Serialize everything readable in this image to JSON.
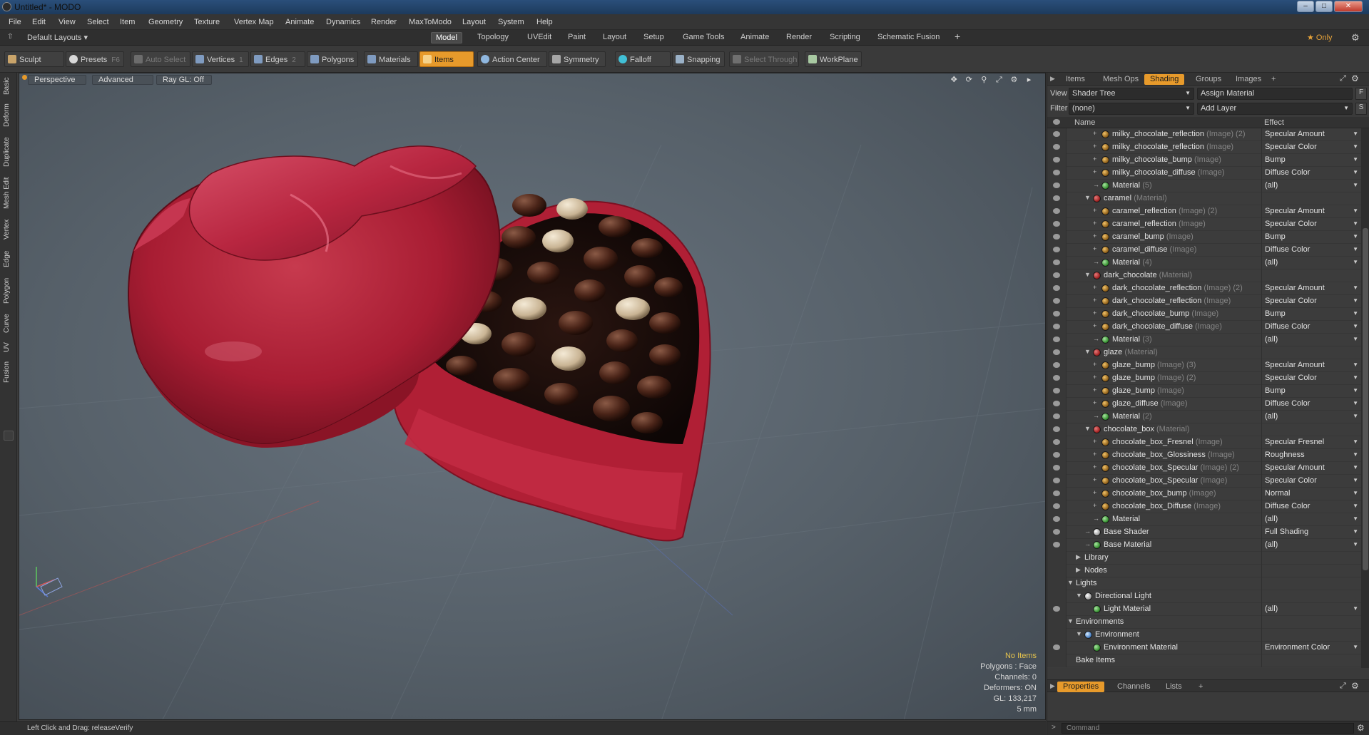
{
  "window": {
    "title": "Untitled* - MODO"
  },
  "menu": [
    "File",
    "Edit",
    "View",
    "Select",
    "Item",
    "Geometry",
    "Texture",
    "Vertex Map",
    "Animate",
    "Dynamics",
    "Render",
    "MaxToModo",
    "Layout",
    "System",
    "Help"
  ],
  "layoutbar": {
    "layout_select": "Default Layouts ▾",
    "tabs": [
      "Model",
      "Topology",
      "UVEdit",
      "Paint",
      "Layout",
      "Setup",
      "Game Tools",
      "Animate",
      "Render",
      "Scripting",
      "Schematic Fusion"
    ],
    "active_tab": "Model",
    "add": "+",
    "only_label": "★ Only"
  },
  "toolbar": {
    "sculpt": "Sculpt",
    "presets": "Presets",
    "presets_key": "F6",
    "auto_select": "Auto Select",
    "vertices": "Vertices",
    "vertices_key": "1",
    "edges": "Edges",
    "edges_key": "2",
    "polygons": "Polygons",
    "materials": "Materials",
    "items": "Items",
    "action_center": "Action Center",
    "symmetry": "Symmetry",
    "falloff": "Falloff",
    "snapping": "Snapping",
    "select_through": "Select Through",
    "workplane": "WorkPlane"
  },
  "left_tabs": [
    "Basic",
    "Deform",
    "Duplicate",
    "Mesh Edit",
    "Vertex",
    "Edge",
    "Polygon",
    "Curve",
    "UV",
    "Fusion"
  ],
  "viewport": {
    "view_mode": "Perspective",
    "shading": "Advanced",
    "raygl": "Ray GL: Off",
    "info": {
      "no_items": "No Items",
      "polygons": "Polygons : Face",
      "channels": "Channels: 0",
      "deformers": "Deformers: ON",
      "gl": "GL: 133,217",
      "scale": "5 mm"
    }
  },
  "status": {
    "text": "Left Click and Drag:   releaseVerify"
  },
  "right_panel": {
    "tabs": [
      "Items",
      "Mesh Ops",
      "Shading",
      "Groups",
      "Images"
    ],
    "active_tab": "Shading",
    "add": "+",
    "view_label": "View",
    "view_value": "Shader Tree",
    "assign_material": "Assign Material",
    "assign_btn": "F",
    "filter_label": "Filter",
    "filter_value": "(none)",
    "add_layer": "Add Layer",
    "add_layer_btn": "S",
    "col_name": "Name",
    "col_effect": "Effect",
    "rows": [
      {
        "name": "milky_chocolate_reflection",
        "type": "(Image) (2)",
        "effect": "Specular Amount",
        "icon": "img",
        "depth": 3,
        "tw": "+"
      },
      {
        "name": "milky_chocolate_reflection",
        "type": "(Image)",
        "effect": "Specular Color",
        "icon": "img",
        "depth": 3,
        "tw": "+"
      },
      {
        "name": "milky_chocolate_bump",
        "type": "(Image)",
        "effect": "Bump",
        "icon": "img",
        "depth": 3,
        "tw": "+"
      },
      {
        "name": "milky_chocolate_diffuse",
        "type": "(Image)",
        "effect": "Diffuse Color",
        "icon": "img",
        "depth": 3,
        "tw": "+"
      },
      {
        "name": "Material",
        "type": "(5)",
        "effect": "(all)",
        "icon": "grn",
        "depth": 3,
        "tw": "→"
      },
      {
        "name": "caramel",
        "type": "(Material)",
        "effect": "",
        "icon": "mat",
        "depth": 2,
        "tw": "▼"
      },
      {
        "name": "caramel_reflection",
        "type": "(Image) (2)",
        "effect": "Specular Amount",
        "icon": "img",
        "depth": 3,
        "tw": "+"
      },
      {
        "name": "caramel_reflection",
        "type": "(Image)",
        "effect": "Specular Color",
        "icon": "img",
        "depth": 3,
        "tw": "+"
      },
      {
        "name": "caramel_bump",
        "type": "(Image)",
        "effect": "Bump",
        "icon": "img",
        "depth": 3,
        "tw": "+"
      },
      {
        "name": "caramel_diffuse",
        "type": "(Image)",
        "effect": "Diffuse Color",
        "icon": "img",
        "depth": 3,
        "tw": "+"
      },
      {
        "name": "Material",
        "type": "(4)",
        "effect": "(all)",
        "icon": "grn",
        "depth": 3,
        "tw": "→"
      },
      {
        "name": "dark_chocolate",
        "type": "(Material)",
        "effect": "",
        "icon": "mat",
        "depth": 2,
        "tw": "▼"
      },
      {
        "name": "dark_chocolate_reflection",
        "type": "(Image) (2)",
        "effect": "Specular Amount",
        "icon": "img",
        "depth": 3,
        "tw": "+"
      },
      {
        "name": "dark_chocolate_reflection",
        "type": "(Image)",
        "effect": "Specular Color",
        "icon": "img",
        "depth": 3,
        "tw": "+"
      },
      {
        "name": "dark_chocolate_bump",
        "type": "(Image)",
        "effect": "Bump",
        "icon": "img",
        "depth": 3,
        "tw": "+"
      },
      {
        "name": "dark_chocolate_diffuse",
        "type": "(Image)",
        "effect": "Diffuse Color",
        "icon": "img",
        "depth": 3,
        "tw": "+"
      },
      {
        "name": "Material",
        "type": "(3)",
        "effect": "(all)",
        "icon": "grn",
        "depth": 3,
        "tw": "→"
      },
      {
        "name": "glaze",
        "type": "(Material)",
        "effect": "",
        "icon": "mat",
        "depth": 2,
        "tw": "▼"
      },
      {
        "name": "glaze_bump",
        "type": "(Image) (3)",
        "effect": "Specular Amount",
        "icon": "img",
        "depth": 3,
        "tw": "+"
      },
      {
        "name": "glaze_bump",
        "type": "(Image) (2)",
        "effect": "Specular Color",
        "icon": "img",
        "depth": 3,
        "tw": "+"
      },
      {
        "name": "glaze_bump",
        "type": "(Image)",
        "effect": "Bump",
        "icon": "img",
        "depth": 3,
        "tw": "+"
      },
      {
        "name": "glaze_diffuse",
        "type": "(Image)",
        "effect": "Diffuse Color",
        "icon": "img",
        "depth": 3,
        "tw": "+"
      },
      {
        "name": "Material",
        "type": "(2)",
        "effect": "(all)",
        "icon": "grn",
        "depth": 3,
        "tw": "→"
      },
      {
        "name": "chocolate_box",
        "type": "(Material)",
        "effect": "",
        "icon": "mat",
        "depth": 2,
        "tw": "▼"
      },
      {
        "name": "chocolate_box_Fresnel",
        "type": "(Image)",
        "effect": "Specular Fresnel",
        "icon": "img",
        "depth": 3,
        "tw": "+"
      },
      {
        "name": "chocolate_box_Glossiness",
        "type": "(Image)",
        "effect": "Roughness",
        "icon": "img",
        "depth": 3,
        "tw": "+"
      },
      {
        "name": "chocolate_box_Specular",
        "type": "(Image) (2)",
        "effect": "Specular Amount",
        "icon": "img",
        "depth": 3,
        "tw": "+"
      },
      {
        "name": "chocolate_box_Specular",
        "type": "(Image)",
        "effect": "Specular Color",
        "icon": "img",
        "depth": 3,
        "tw": "+"
      },
      {
        "name": "chocolate_box_bump",
        "type": "(Image)",
        "effect": "Normal",
        "icon": "img",
        "depth": 3,
        "tw": "+"
      },
      {
        "name": "chocolate_box_Diffuse",
        "type": "(Image)",
        "effect": "Diffuse Color",
        "icon": "img",
        "depth": 3,
        "tw": "+"
      },
      {
        "name": "Material",
        "type": "",
        "effect": "(all)",
        "icon": "grn",
        "depth": 3,
        "tw": "→"
      },
      {
        "name": "Base Shader",
        "type": "",
        "effect": "Full Shading",
        "icon": "wht",
        "depth": 2,
        "tw": "→"
      },
      {
        "name": "Base Material",
        "type": "",
        "effect": "(all)",
        "icon": "grn",
        "depth": 2,
        "tw": "→"
      },
      {
        "name": "Library",
        "type": "",
        "effect": "",
        "icon": "",
        "depth": 1,
        "tw": "▶"
      },
      {
        "name": "Nodes",
        "type": "",
        "effect": "",
        "icon": "",
        "depth": 1,
        "tw": "▶"
      },
      {
        "name": "Lights",
        "type": "",
        "effect": "",
        "icon": "",
        "depth": 0,
        "tw": "▼"
      },
      {
        "name": "Directional Light",
        "type": "",
        "effect": "",
        "icon": "wht",
        "depth": 1,
        "tw": "▼"
      },
      {
        "name": "Light Material",
        "type": "",
        "effect": "(all)",
        "icon": "grn",
        "depth": 2,
        "tw": ""
      },
      {
        "name": "Environments",
        "type": "",
        "effect": "",
        "icon": "",
        "depth": 0,
        "tw": "▼"
      },
      {
        "name": "Environment",
        "type": "",
        "effect": "",
        "icon": "env",
        "depth": 1,
        "tw": "▼"
      },
      {
        "name": "Environment Material",
        "type": "",
        "effect": "Environment Color",
        "icon": "grn",
        "depth": 2,
        "tw": ""
      },
      {
        "name": "Bake Items",
        "type": "",
        "effect": "",
        "icon": "",
        "depth": 0,
        "tw": ""
      }
    ],
    "props_tabs": [
      "Properties",
      "Channels",
      "Lists"
    ],
    "props_active": "Properties",
    "command_placeholder": "Command"
  }
}
